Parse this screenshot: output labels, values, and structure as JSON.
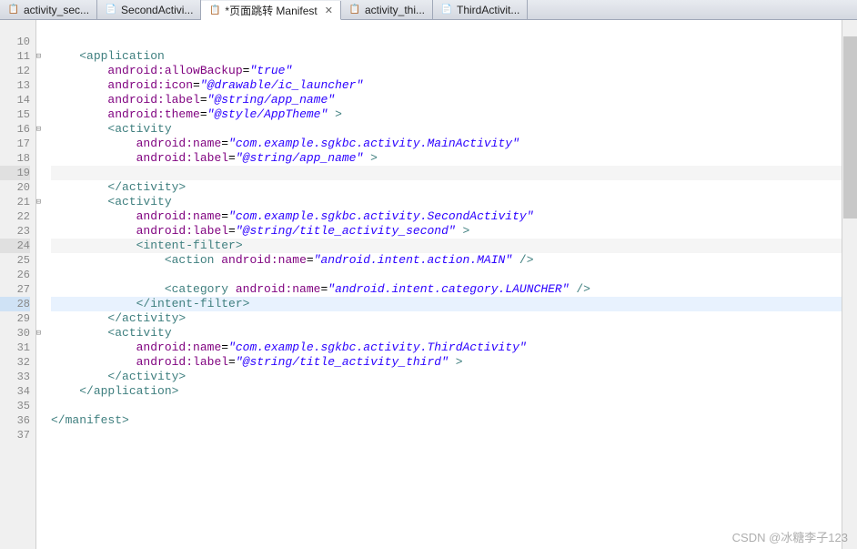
{
  "tabs": [
    {
      "icon": "xml",
      "label": "activity_sec...",
      "active": false
    },
    {
      "icon": "java",
      "label": "SecondActivi...",
      "active": false
    },
    {
      "icon": "xml",
      "label": "*页面跳转 Manifest",
      "active": true,
      "closeable": true
    },
    {
      "icon": "xml",
      "label": "activity_thi...",
      "active": false
    },
    {
      "icon": "java",
      "label": "ThirdActivit...",
      "active": false
    }
  ],
  "watermark": "CSDN @冰糖李子123",
  "lines": [
    {
      "n": "",
      "tokens": []
    },
    {
      "n": "10",
      "tokens": []
    },
    {
      "n": "11",
      "fold": true,
      "tokens": [
        {
          "t": "    "
        },
        {
          "t": "<application",
          "c": "tag"
        }
      ]
    },
    {
      "n": "12",
      "tokens": [
        {
          "t": "        "
        },
        {
          "t": "android:allowBackup",
          "c": "attr-name"
        },
        {
          "t": "="
        },
        {
          "t": "\"true\"",
          "c": "attr-val"
        }
      ]
    },
    {
      "n": "13",
      "tokens": [
        {
          "t": "        "
        },
        {
          "t": "android:icon",
          "c": "attr-name"
        },
        {
          "t": "="
        },
        {
          "t": "\"@drawable/ic_launcher\"",
          "c": "attr-val"
        }
      ]
    },
    {
      "n": "14",
      "tokens": [
        {
          "t": "        "
        },
        {
          "t": "android:label",
          "c": "attr-name"
        },
        {
          "t": "="
        },
        {
          "t": "\"@string/app_name\"",
          "c": "attr-val"
        }
      ]
    },
    {
      "n": "15",
      "tokens": [
        {
          "t": "        "
        },
        {
          "t": "android:theme",
          "c": "attr-name"
        },
        {
          "t": "="
        },
        {
          "t": "\"@style/AppTheme\"",
          "c": "attr-val"
        },
        {
          "t": " >",
          "c": "tag"
        }
      ]
    },
    {
      "n": "16",
      "fold": true,
      "tokens": [
        {
          "t": "        "
        },
        {
          "t": "<activity",
          "c": "tag"
        }
      ]
    },
    {
      "n": "17",
      "tokens": [
        {
          "t": "            "
        },
        {
          "t": "android:name",
          "c": "attr-name"
        },
        {
          "t": "="
        },
        {
          "t": "\"com.example.sgkbc.activity.MainActivity\"",
          "c": "attr-val"
        }
      ]
    },
    {
      "n": "18",
      "tokens": [
        {
          "t": "            "
        },
        {
          "t": "android:label",
          "c": "attr-name"
        },
        {
          "t": "="
        },
        {
          "t": "\"@string/app_name\"",
          "c": "attr-val"
        },
        {
          "t": " >",
          "c": "tag"
        }
      ]
    },
    {
      "n": "19",
      "hl": true,
      "tokens": []
    },
    {
      "n": "20",
      "tokens": [
        {
          "t": "        "
        },
        {
          "t": "</activity>",
          "c": "tag"
        }
      ]
    },
    {
      "n": "21",
      "fold": true,
      "tokens": [
        {
          "t": "        "
        },
        {
          "t": "<activity",
          "c": "tag"
        }
      ]
    },
    {
      "n": "22",
      "tokens": [
        {
          "t": "            "
        },
        {
          "t": "android:name",
          "c": "attr-name"
        },
        {
          "t": "="
        },
        {
          "t": "\"com.example.sgkbc.activity.SecondActivity\"",
          "c": "attr-val"
        }
      ]
    },
    {
      "n": "23",
      "tokens": [
        {
          "t": "            "
        },
        {
          "t": "android:label",
          "c": "attr-name"
        },
        {
          "t": "="
        },
        {
          "t": "\"@string/title_activity_second\"",
          "c": "attr-val"
        },
        {
          "t": " >",
          "c": "tag"
        }
      ]
    },
    {
      "n": "24",
      "hl": true,
      "tokens": [
        {
          "t": "            "
        },
        {
          "t": "<intent-filter>",
          "c": "tag"
        }
      ]
    },
    {
      "n": "25",
      "tokens": [
        {
          "t": "                "
        },
        {
          "t": "<action ",
          "c": "tag"
        },
        {
          "t": "android:name",
          "c": "attr-name"
        },
        {
          "t": "="
        },
        {
          "t": "\"android.intent.action.MAIN\"",
          "c": "attr-val"
        },
        {
          "t": " />",
          "c": "tag"
        }
      ]
    },
    {
      "n": "26",
      "tokens": []
    },
    {
      "n": "27",
      "tokens": [
        {
          "t": "                "
        },
        {
          "t": "<category ",
          "c": "tag"
        },
        {
          "t": "android:name",
          "c": "attr-name"
        },
        {
          "t": "="
        },
        {
          "t": "\"android.intent.category.LAUNCHER\"",
          "c": "attr-val"
        },
        {
          "t": " />",
          "c": "tag"
        }
      ]
    },
    {
      "n": "28",
      "current": true,
      "tokens": [
        {
          "t": "            "
        },
        {
          "t": "</intent-filter>",
          "c": "tag"
        }
      ]
    },
    {
      "n": "29",
      "tokens": [
        {
          "t": "        "
        },
        {
          "t": "</activity>",
          "c": "tag"
        }
      ]
    },
    {
      "n": "30",
      "fold": true,
      "tokens": [
        {
          "t": "        "
        },
        {
          "t": "<activity",
          "c": "tag"
        }
      ]
    },
    {
      "n": "31",
      "tokens": [
        {
          "t": "            "
        },
        {
          "t": "android:name",
          "c": "attr-name"
        },
        {
          "t": "="
        },
        {
          "t": "\"com.example.sgkbc.activity.ThirdActivity\"",
          "c": "attr-val"
        }
      ]
    },
    {
      "n": "32",
      "tokens": [
        {
          "t": "            "
        },
        {
          "t": "android:label",
          "c": "attr-name"
        },
        {
          "t": "="
        },
        {
          "t": "\"@string/title_activity_third\"",
          "c": "attr-val"
        },
        {
          "t": " >",
          "c": "tag"
        }
      ]
    },
    {
      "n": "33",
      "tokens": [
        {
          "t": "        "
        },
        {
          "t": "</activity>",
          "c": "tag"
        }
      ]
    },
    {
      "n": "34",
      "tokens": [
        {
          "t": "    "
        },
        {
          "t": "</application>",
          "c": "tag"
        }
      ]
    },
    {
      "n": "35",
      "tokens": []
    },
    {
      "n": "36",
      "tokens": [
        {
          "t": "</manifest>",
          "c": "tag"
        }
      ]
    },
    {
      "n": "37",
      "tokens": []
    }
  ]
}
